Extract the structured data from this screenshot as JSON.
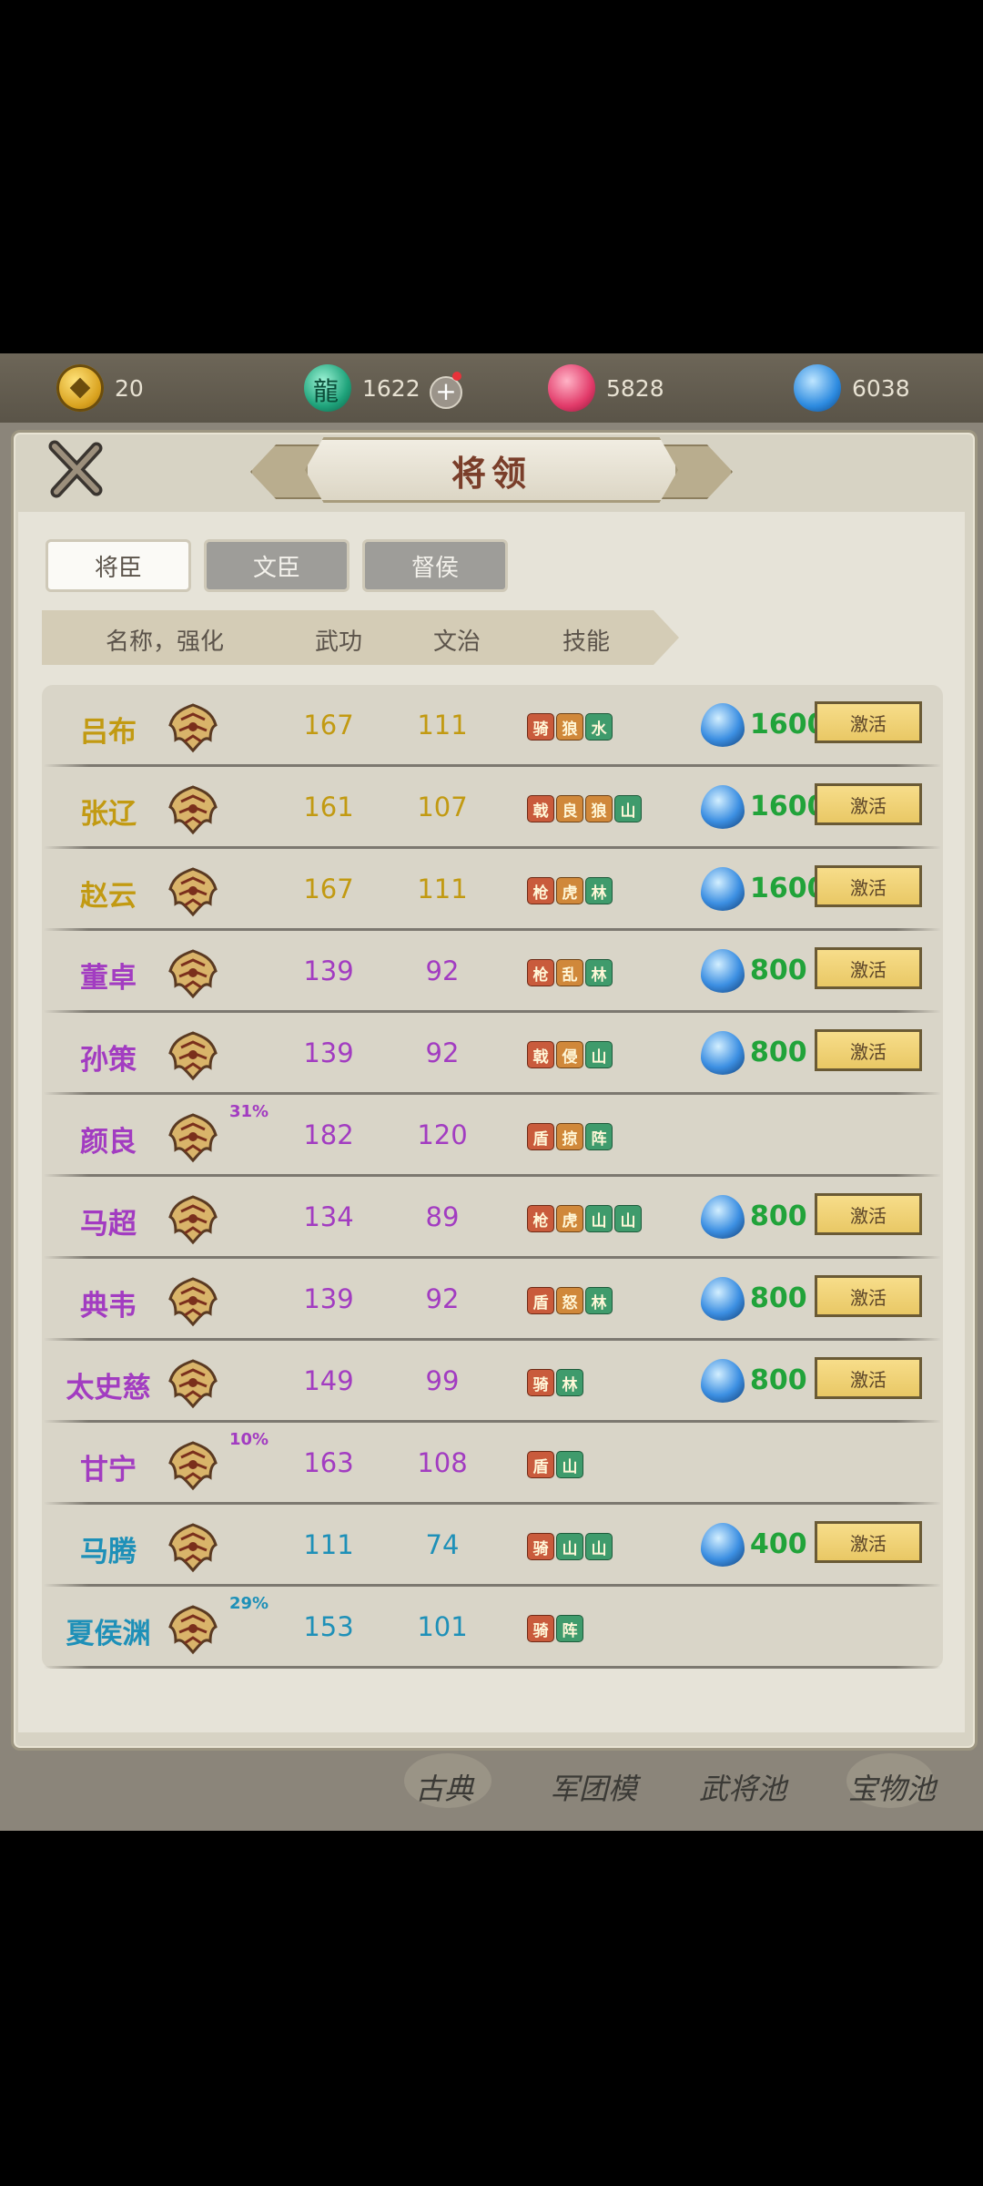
{
  "resources": {
    "coins": "20",
    "jade": "1622",
    "red_orbs": "5828",
    "blue_orbs": "6038"
  },
  "panel_title": "将领",
  "tabs": [
    {
      "label": "将臣",
      "active": true
    },
    {
      "label": "文臣",
      "active": false
    },
    {
      "label": "督侯",
      "active": false
    }
  ],
  "columns": {
    "name": "名称，强化",
    "wu": "武功",
    "wen": "文治",
    "skills": "技能"
  },
  "activate_label": "激活",
  "rows": [
    {
      "name": "吕布",
      "wu": "167",
      "wen": "111",
      "skills": [
        "骑",
        "狼",
        "水"
      ],
      "cost": "1600",
      "pct": "",
      "rarity": "gold"
    },
    {
      "name": "张辽",
      "wu": "161",
      "wen": "107",
      "skills": [
        "戟",
        "良",
        "狼",
        "山"
      ],
      "cost": "1600",
      "pct": "",
      "rarity": "gold"
    },
    {
      "name": "赵云",
      "wu": "167",
      "wen": "111",
      "skills": [
        "枪",
        "虎",
        "林"
      ],
      "cost": "1600",
      "pct": "",
      "rarity": "gold"
    },
    {
      "name": "董卓",
      "wu": "139",
      "wen": "92",
      "skills": [
        "枪",
        "乱",
        "林"
      ],
      "cost": "800",
      "pct": "",
      "rarity": "purple"
    },
    {
      "name": "孙策",
      "wu": "139",
      "wen": "92",
      "skills": [
        "戟",
        "侵",
        "山"
      ],
      "cost": "800",
      "pct": "",
      "rarity": "purple"
    },
    {
      "name": "颜良",
      "wu": "182",
      "wen": "120",
      "skills": [
        "盾",
        "掠",
        "阵"
      ],
      "cost": "",
      "pct": "31%",
      "rarity": "purple"
    },
    {
      "name": "马超",
      "wu": "134",
      "wen": "89",
      "skills": [
        "枪",
        "虎",
        "山",
        "山"
      ],
      "cost": "800",
      "pct": "",
      "rarity": "purple"
    },
    {
      "name": "典韦",
      "wu": "139",
      "wen": "92",
      "skills": [
        "盾",
        "怒",
        "林"
      ],
      "cost": "800",
      "pct": "",
      "rarity": "purple"
    },
    {
      "name": "太史慈",
      "wu": "149",
      "wen": "99",
      "skills": [
        "骑",
        "林"
      ],
      "cost": "800",
      "pct": "",
      "rarity": "purple"
    },
    {
      "name": "甘宁",
      "wu": "163",
      "wen": "108",
      "skills": [
        "盾",
        "山"
      ],
      "cost": "",
      "pct": "10%",
      "rarity": "purple"
    },
    {
      "name": "马腾",
      "wu": "111",
      "wen": "74",
      "skills": [
        "骑",
        "山",
        "山"
      ],
      "cost": "400",
      "pct": "",
      "rarity": "blue"
    },
    {
      "name": "夏侯渊",
      "wu": "153",
      "wen": "101",
      "skills": [
        "骑",
        "阵"
      ],
      "cost": "",
      "pct": "29%",
      "rarity": "blue"
    }
  ],
  "bottom_nav": [
    "古典",
    "军团模",
    "武将池",
    "宝物池"
  ]
}
